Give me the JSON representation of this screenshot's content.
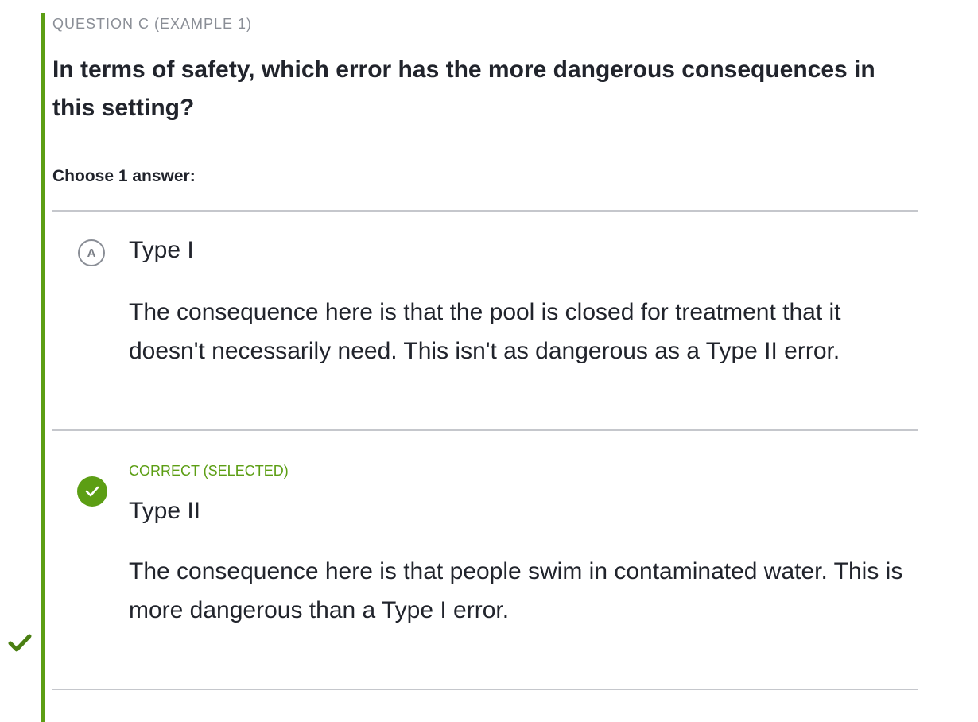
{
  "eyebrow": "QUESTION C (EXAMPLE 1)",
  "question": "In terms of safety, which error has the more dangerous consequences in this setting?",
  "choose_label": "Choose 1 answer:",
  "choices": [
    {
      "letter": "A",
      "title": "Type I",
      "rationale": "The consequence here is that the pool is closed for treatment that it doesn't necessarily need. This isn't as dangerous as a Type II error."
    },
    {
      "status": "CORRECT (SELECTED)",
      "title": "Type II",
      "rationale": "The consequence here is that people swim in contaminated water. This is more dangerous than a Type I error.",
      "icon": "check-icon"
    }
  ],
  "side_status_icon": "check-icon",
  "colors": {
    "accent_green": "#5c9e14",
    "text": "#21242c",
    "muted": "#8a8e96",
    "divider": "#c5c7cc"
  }
}
